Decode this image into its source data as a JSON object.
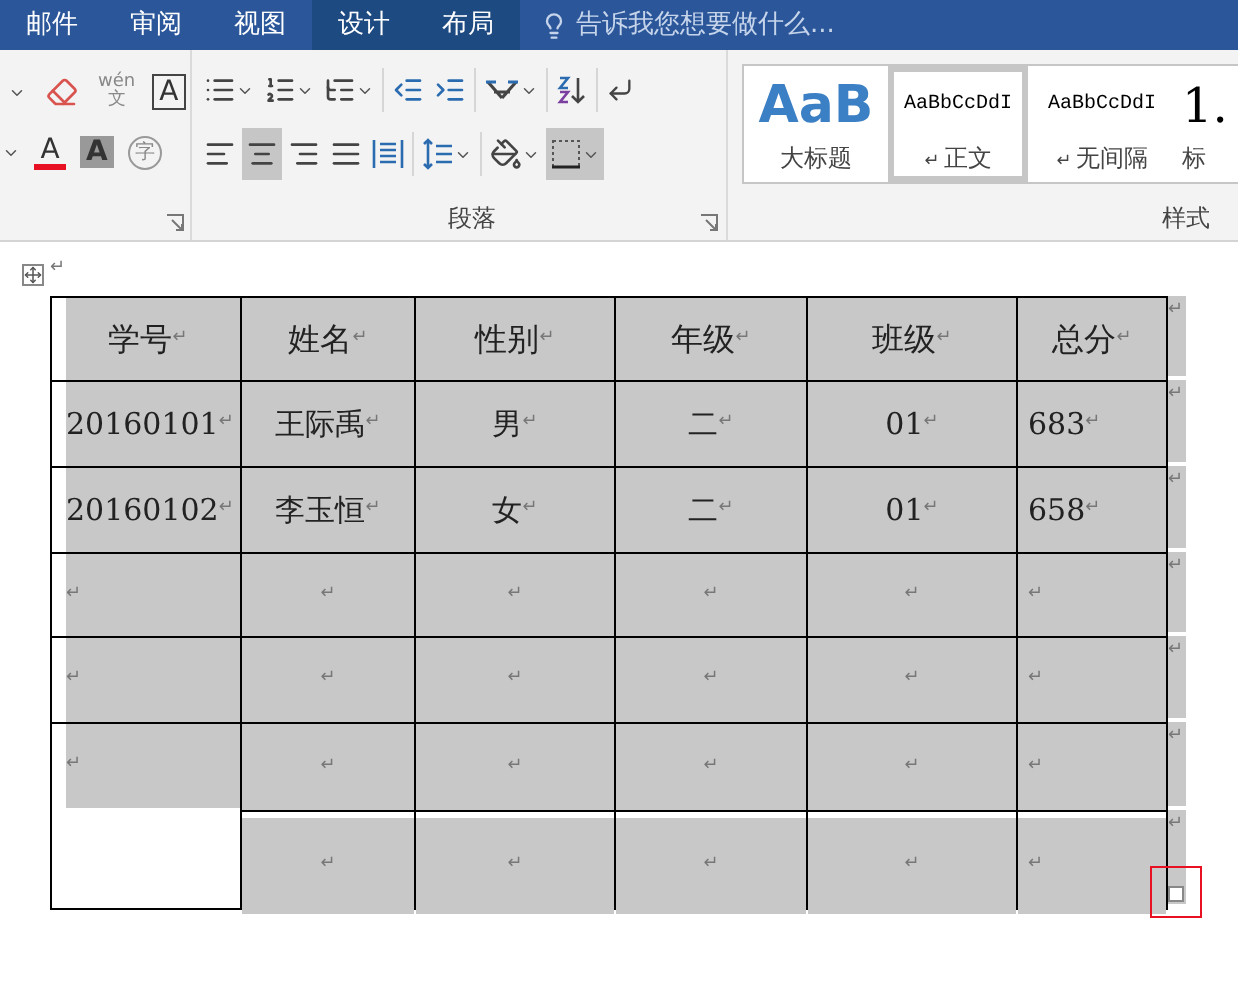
{
  "ribbon_tabs": [
    {
      "label": "邮件",
      "contextual": false
    },
    {
      "label": "审阅",
      "contextual": false
    },
    {
      "label": "视图",
      "contextual": false
    },
    {
      "label": "设计",
      "contextual": true
    },
    {
      "label": "布局",
      "contextual": true
    }
  ],
  "tell_me": {
    "placeholder": "告诉我您想要做什么..."
  },
  "font_tools": [
    {
      "kind": "caret"
    },
    {
      "kind": "eraser"
    },
    {
      "kind": "phonetic",
      "glyph": "wén",
      "glyph2": "文"
    },
    {
      "kind": "boxed",
      "glyph": "A"
    },
    {
      "kind": "caret"
    },
    {
      "kind": "font-color",
      "glyph": "A",
      "color": "#e81123"
    },
    {
      "kind": "shaded",
      "glyph": "A"
    },
    {
      "kind": "circled",
      "glyph": "字"
    }
  ],
  "paragraph_group": {
    "label": "段落",
    "row_1": [
      {
        "kind": "bullets",
        "selected": false
      },
      {
        "kind": "numbering",
        "selected": false
      },
      {
        "kind": "multilevel",
        "selected": false
      },
      {
        "kind": "outdent",
        "selected": false
      },
      {
        "kind": "indent",
        "selected": false
      },
      {
        "kind": "asian-layout",
        "selected": false
      },
      {
        "kind": "sort",
        "selected": false
      },
      {
        "kind": "marks",
        "selected": false
      }
    ],
    "row_2": [
      {
        "kind": "align-left",
        "selected": false
      },
      {
        "kind": "align-center",
        "selected": true
      },
      {
        "kind": "align-right",
        "selected": false
      },
      {
        "kind": "justify",
        "selected": false
      },
      {
        "kind": "distribute",
        "selected": false
      },
      {
        "kind": "line-spacing",
        "selected": false
      },
      {
        "kind": "shading",
        "selected": false
      },
      {
        "kind": "borders",
        "selected": true
      }
    ]
  },
  "styles_group": {
    "label": "样式",
    "items": [
      {
        "preview": "AaB",
        "name": "大标题",
        "selected": false,
        "kind": "title"
      },
      {
        "preview": "AaBbCcDdI",
        "name": "正文",
        "mark": "↵",
        "selected": true,
        "kind": "normal"
      },
      {
        "preview": "AaBbCcDdI",
        "name": "无间隔",
        "mark": "↵",
        "selected": false,
        "kind": "normal"
      },
      {
        "preview": "1.",
        "name": "标",
        "selected": false,
        "kind": "heading"
      }
    ]
  },
  "document": {
    "mark_above_table": "↵",
    "table": {
      "rows": [
        {
          "end_mark": "↵",
          "cells": [
            {
              "text": "学号",
              "mark": "↵"
            },
            {
              "text": "姓名",
              "mark": "↵"
            },
            {
              "text": "性别",
              "mark": "↵"
            },
            {
              "text": "年级",
              "mark": "↵"
            },
            {
              "text": "班级",
              "mark": "↵"
            },
            {
              "text": "总分",
              "mark": "↵"
            }
          ]
        },
        {
          "end_mark": "↵",
          "cells": [
            {
              "text": "20160101",
              "mark": "↵"
            },
            {
              "text": "王际禹",
              "mark": "↵"
            },
            {
              "text": "男",
              "mark": "↵"
            },
            {
              "text": "二",
              "mark": "↵"
            },
            {
              "text": "01",
              "mark": "↵"
            },
            {
              "text": "683",
              "mark": "↵"
            }
          ]
        },
        {
          "end_mark": "↵",
          "cells": [
            {
              "text": "20160102",
              "mark": "↵"
            },
            {
              "text": "李玉恒",
              "mark": "↵"
            },
            {
              "text": "女",
              "mark": "↵"
            },
            {
              "text": "二",
              "mark": "↵"
            },
            {
              "text": "01",
              "mark": "↵"
            },
            {
              "text": "658",
              "mark": "↵"
            }
          ]
        },
        {
          "end_mark": "↵",
          "cells": [
            {
              "mark": "↵"
            },
            {
              "mark": "↵"
            },
            {
              "mark": "↵"
            },
            {
              "mark": "↵"
            },
            {
              "mark": "↵"
            },
            {
              "mark": "↵"
            }
          ]
        },
        {
          "end_mark": "↵",
          "cells": [
            {
              "mark": "↵"
            },
            {
              "mark": "↵"
            },
            {
              "mark": "↵"
            },
            {
              "mark": "↵"
            },
            {
              "mark": "↵"
            },
            {
              "mark": "↵"
            }
          ]
        },
        {
          "end_mark": "↵",
          "cells": [
            {
              "mark": "↵",
              "spans_next_row": true
            },
            {
              "mark": "↵"
            },
            {
              "mark": "↵"
            },
            {
              "mark": "↵"
            },
            {
              "mark": "↵"
            },
            {
              "mark": "↵"
            }
          ]
        },
        {
          "end_mark": "↵",
          "cells": [
            "",
            {
              "mark": "↵"
            },
            {
              "mark": "↵"
            },
            {
              "mark": "↵"
            },
            {
              "mark": "↵"
            },
            {
              "mark": "↵"
            }
          ]
        }
      ]
    },
    "resize_handle_highlighted": true
  }
}
